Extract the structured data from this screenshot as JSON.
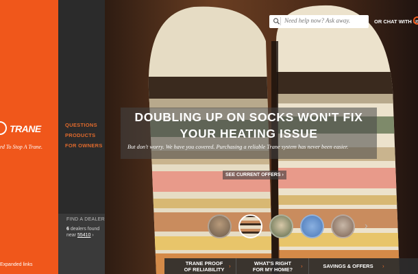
{
  "brand": {
    "logo": "TRANE",
    "tagline": "rd To Stop A Trane.",
    "expanded_link": "Expanded links",
    "color": "#f0571b"
  },
  "nav": {
    "items": [
      "QUESTIONS",
      "PRODUCTS",
      "FOR OWNERS"
    ],
    "color": "#e06a2c"
  },
  "dealer": {
    "title": "FIND A DEALER",
    "count": "6",
    "found_text": "dealers found",
    "near": "near",
    "zip": "55410",
    "arrow": "›"
  },
  "search": {
    "placeholder": "Need help now? Ask away.",
    "chat_label": "OR CHAT WITH US"
  },
  "hero": {
    "headline_line1": "DOUBLING UP ON SOCKS WON'T FIX",
    "headline_line2": "YOUR HEATING ISSUE",
    "subtext": "But don't worry. We have you covered. Purchasing a reliable Trane system has never been easier.",
    "cta": "SEE CURRENT OFFERS ›"
  },
  "thumbnails": {
    "count": 5,
    "active_index": 1,
    "next_arrow": "›"
  },
  "bottom_tabs": [
    {
      "line1": "TRANE PROOF",
      "line2": "OF RELIABILITY"
    },
    {
      "line1": "WHAT'S RIGHT",
      "line2": "FOR MY HOME?"
    },
    {
      "line1": "SAVINGS & OFFERS",
      "line2": ""
    }
  ],
  "tab_arrow": "›"
}
